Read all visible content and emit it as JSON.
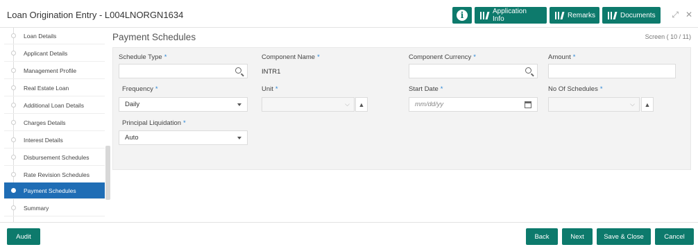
{
  "header": {
    "title": "Loan Origination Entry - L004LNORGN1634",
    "buttons": {
      "application_info": "Application Info",
      "remarks": "Remarks",
      "documents": "Documents"
    }
  },
  "sidebar": {
    "items": [
      {
        "label": "Loan Details"
      },
      {
        "label": "Applicant Details"
      },
      {
        "label": "Management Profile"
      },
      {
        "label": "Real Estate Loan"
      },
      {
        "label": "Additional Loan Details"
      },
      {
        "label": "Charges Details"
      },
      {
        "label": "Interest Details"
      },
      {
        "label": "Disbursement Schedules"
      },
      {
        "label": "Rate Revision Schedules"
      },
      {
        "label": "Payment Schedules",
        "active": true
      },
      {
        "label": "Summary"
      }
    ]
  },
  "main": {
    "title": "Payment Schedules",
    "screen": "Screen ( 10 / 11)",
    "fields": {
      "schedule_type": {
        "label": "Schedule Type",
        "value": ""
      },
      "component_name": {
        "label": "Component Name",
        "value": "INTR1"
      },
      "component_currency": {
        "label": "Component Currency",
        "value": ""
      },
      "amount": {
        "label": "Amount",
        "value": ""
      },
      "frequency": {
        "label": "Frequency",
        "value": "Daily"
      },
      "unit": {
        "label": "Unit",
        "value": ""
      },
      "start_date": {
        "label": "Start Date",
        "placeholder": "mm/dd/yy"
      },
      "no_of_schedules": {
        "label": "No Of Schedules",
        "value": ""
      },
      "principal_liquidation": {
        "label": "Principal Liquidation",
        "value": "Auto"
      }
    },
    "required_mark": "*"
  },
  "footer": {
    "audit": "Audit",
    "back": "Back",
    "next": "Next",
    "save_close": "Save & Close",
    "cancel": "Cancel"
  },
  "colors": {
    "primary": "#0d7a6c",
    "active_nav": "#1f6db5",
    "required": "#2a86d6"
  }
}
